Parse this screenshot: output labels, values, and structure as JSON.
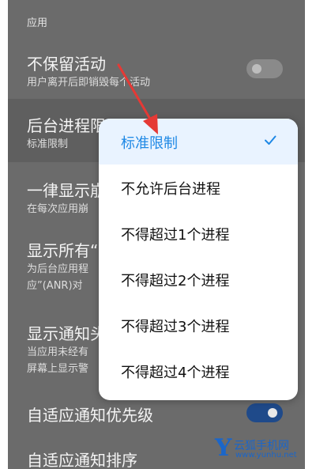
{
  "section": {
    "label": "应用"
  },
  "settings": [
    {
      "title": "不保留活动",
      "subtitle": "用户离开后即销毁每个活动"
    },
    {
      "title": "后台进程限",
      "subtitle": "标准限制"
    },
    {
      "title": "一律显示崩",
      "subtitle": "在每次应用崩"
    },
    {
      "title": "显示所有“",
      "subtitle": "为后台应用程",
      "subtitle2": "应”(ANR)对"
    },
    {
      "title": "显示通知头",
      "subtitle": "当应用未经有",
      "subtitle2": "屏幕上显示警"
    },
    {
      "title": "自适应通知优先级",
      "subtitle": ""
    },
    {
      "title": "自适应通知排序",
      "subtitle": ""
    }
  ],
  "toggles": {
    "dont_keep_activities": false,
    "adaptive_priority": true
  },
  "popup": {
    "selected_index": 0,
    "options": [
      "标准限制",
      "不允许后台进程",
      "不得超过1个进程",
      "不得超过2个进程",
      "不得超过3个进程",
      "不得超过4个进程"
    ]
  },
  "annotation": {
    "arrow_color": "#e53935"
  },
  "watermark": {
    "logo": "Y",
    "title": "云狐手机网",
    "url": "www.yunhu.net"
  },
  "colors": {
    "accent": "#1e88e5",
    "toggle_on": "#1f4a8a"
  }
}
